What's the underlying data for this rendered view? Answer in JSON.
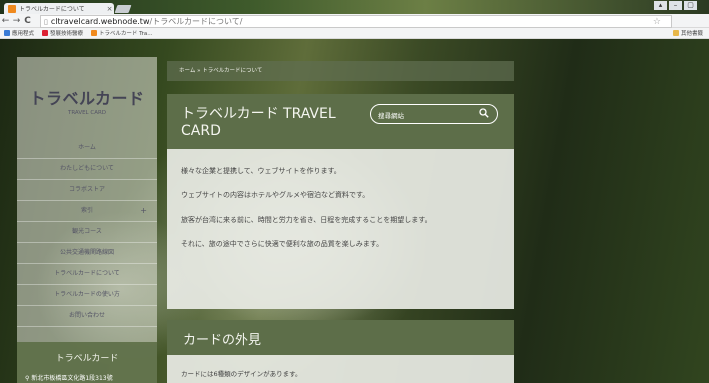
{
  "browser": {
    "tab_title": "トラベルカードについて",
    "tab_close": "×",
    "url_host": "cltravelcard.webnode.tw",
    "url_path": "/トラベルカードについて/",
    "bookmarks": [
      "應用程式",
      "發展技術醫療",
      "トラベルカード Tra..."
    ],
    "bookmark_other": "其他書籤",
    "nav": {
      "back": "←",
      "forward": "→",
      "reload": "C",
      "home": "⌂"
    },
    "window_controls": [
      "▴",
      "–",
      "▢"
    ]
  },
  "sidebar": {
    "logo": "トラベルカード",
    "logo_sub": "TRAVEL CARD",
    "items": [
      {
        "label": "ホーム"
      },
      {
        "label": "わたしどもについて"
      },
      {
        "label": "コラボストア"
      },
      {
        "label": "索引"
      },
      {
        "label": "観光コース"
      },
      {
        "label": "公共交通機関路線図"
      },
      {
        "label": "トラベルカードについて"
      },
      {
        "label": "トラベルカードの使い方"
      },
      {
        "label": "お問い合わせ"
      }
    ],
    "footer_title": "トラベルカード",
    "footer_address": "新北市板橋區文化路1段313號"
  },
  "main": {
    "breadcrumb": "ホーム » トラベルカードについて",
    "title": "トラベルカード TRAVEL CARD",
    "search_placeholder": "搜尋網站",
    "paragraphs": [
      "様々な企業と提携して、ウェブサイトを作ります。",
      "ウェブサイトの内容はホテルやグルメや宿泊など資料です。",
      "旅客が台湾に来る前に、時間と労力を省き、日程を完成することを期望します。",
      "それに、旅の途中でさらに快適で便利な旅の品質を楽しみます。"
    ],
    "section_title": "カードの外見",
    "section_text": "カードには6種類のデザインがあります。"
  },
  "colors": {
    "accent": "#5d6e49",
    "favicon": "#f08a1e"
  }
}
